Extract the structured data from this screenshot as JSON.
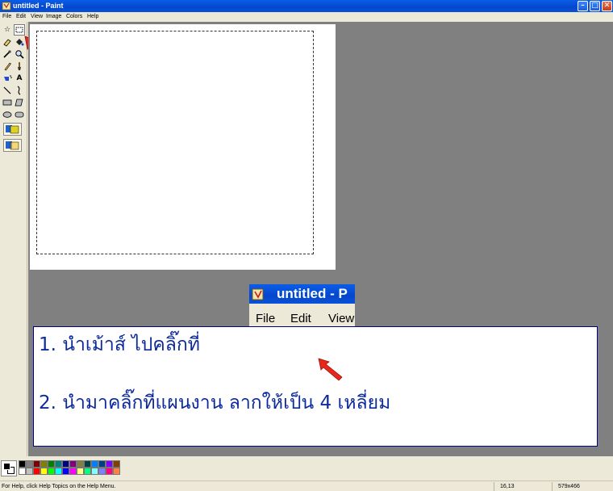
{
  "window": {
    "title": "untitled - Paint",
    "controls": {
      "minimize": "–",
      "maximize": "□",
      "close": "✕"
    }
  },
  "menu": {
    "items": [
      "File",
      "Edit",
      "View",
      "Image",
      "Colors",
      "Help"
    ]
  },
  "tools": {
    "items": [
      {
        "name": "free-form-select",
        "glyph": "☆"
      },
      {
        "name": "rectangle-select",
        "glyph": "▭",
        "selected": true
      },
      {
        "name": "eraser",
        "glyph": "◿"
      },
      {
        "name": "fill-bucket",
        "glyph": "⬥"
      },
      {
        "name": "color-picker",
        "glyph": "╱"
      },
      {
        "name": "magnifier",
        "glyph": "🔍"
      },
      {
        "name": "pencil",
        "glyph": "✎"
      },
      {
        "name": "brush",
        "glyph": "♙"
      },
      {
        "name": "airbrush",
        "glyph": "⌐"
      },
      {
        "name": "text",
        "glyph": "A"
      },
      {
        "name": "line",
        "glyph": "╲"
      },
      {
        "name": "curve",
        "glyph": "∫"
      },
      {
        "name": "rectangle",
        "glyph": "▭"
      },
      {
        "name": "polygon",
        "glyph": "◿"
      },
      {
        "name": "ellipse",
        "glyph": "⬭"
      },
      {
        "name": "rounded-rectangle",
        "glyph": "▢"
      }
    ]
  },
  "inset": {
    "title": "untitled - P",
    "menu_file": "File",
    "menu_edit": "Edit",
    "menu_view": "View",
    "tool_glyph": "☆"
  },
  "note": {
    "line1": "1. นำเม้าส์ ไปคลิ๊กที่",
    "line2": "2. นำมาคลิ๊กที่แผนงาน ลากให้เป็น 4 เหลี่ยม"
  },
  "palette": {
    "colors_top": [
      "#000000",
      "#808080",
      "#800000",
      "#808000",
      "#008000",
      "#008080",
      "#000080",
      "#800080",
      "#808040",
      "#004040",
      "#0080ff",
      "#004080",
      "#8000ff",
      "#804000"
    ],
    "colors_bottom": [
      "#ffffff",
      "#c0c0c0",
      "#ff0000",
      "#ffff00",
      "#00ff00",
      "#00ffff",
      "#0000ff",
      "#ff00ff",
      "#ffff80",
      "#00ff80",
      "#80ffff",
      "#8080ff",
      "#ff0080",
      "#ff8040"
    ]
  },
  "status": {
    "help": "For Help, click Help Topics on the Help Menu.",
    "position": "16,13",
    "size": "579x466"
  },
  "colors": {
    "titlebar": "#0447cc",
    "workspace": "#808080",
    "note_text": "#0d2a9c",
    "arrow": "#e8261c"
  }
}
